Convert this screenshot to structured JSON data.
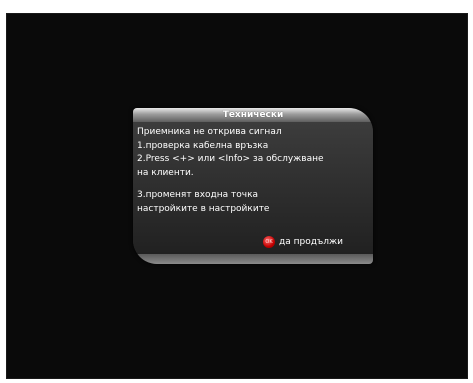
{
  "dialog": {
    "title": "Технически",
    "lines": [
      "Приемника не открива сигнал",
      "1.проверка кабелна връзка",
      "2.Press <+> или <Info> за обслужване",
      "на клиенти.",
      "3.променят входна точка",
      "настройките в настройките"
    ],
    "footer": {
      "button_color": "red",
      "button_text": "OK",
      "label": "да продължи"
    }
  }
}
